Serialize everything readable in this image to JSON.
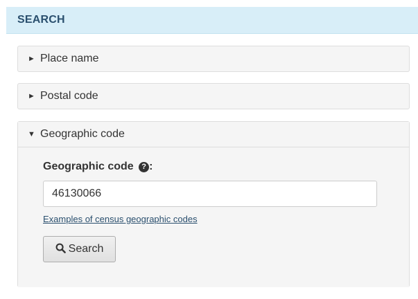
{
  "header": {
    "title": "SEARCH"
  },
  "panels": [
    {
      "label": "Place name",
      "state": "collapsed",
      "caret": "►"
    },
    {
      "label": "Postal code",
      "state": "collapsed",
      "caret": "►"
    },
    {
      "label": "Geographic code",
      "state": "expanded",
      "caret": "▼"
    }
  ],
  "geo_form": {
    "field_label": "Geographic code",
    "field_label_suffix": ":",
    "help_icon_glyph": "?",
    "input_value": "46130066",
    "examples_link": "Examples of census geographic codes",
    "search_button": "Search"
  },
  "colors": {
    "header_bg": "#d8eef8",
    "header_text": "#2a4f6e",
    "link": "#2a4f6e"
  },
  "icons": {
    "collapsed_caret": "triangle-right-icon",
    "expanded_caret": "triangle-down-icon",
    "help": "question-circle-icon",
    "search": "search-icon"
  }
}
